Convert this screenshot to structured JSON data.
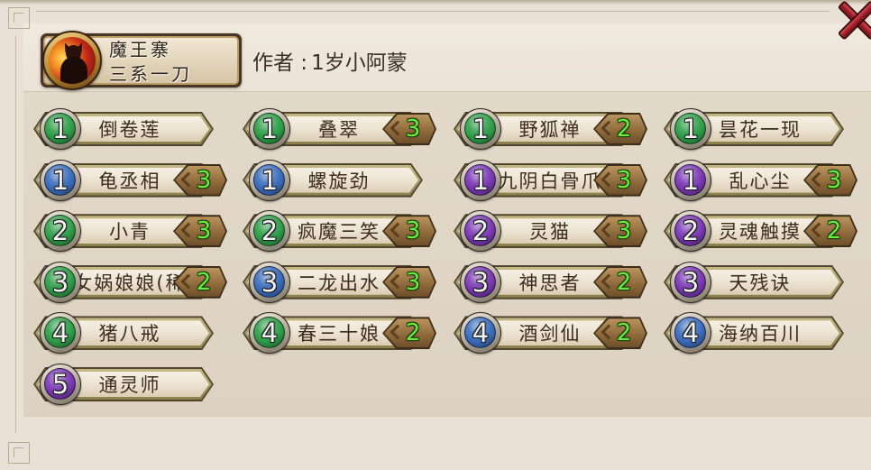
{
  "icons": {
    "close": "close-icon"
  },
  "deck": {
    "name": "魔王寨",
    "subtitle": "三系一刀",
    "author_label": "作者 :",
    "author_name": "1岁小阿蒙"
  },
  "colors": {
    "count_text": "#66ee3a",
    "name_text": "#3b2c1e",
    "close_red": "#b3262e"
  },
  "cards": [
    {
      "cost": 1,
      "name": "倒卷莲",
      "count": null,
      "gem_color": "#2e9e48"
    },
    {
      "cost": 1,
      "name": "叠翠",
      "count": 3,
      "gem_color": "#2e9e48"
    },
    {
      "cost": 1,
      "name": "野狐禅",
      "count": 2,
      "gem_color": "#2e9e48"
    },
    {
      "cost": 1,
      "name": "昙花一现",
      "count": null,
      "gem_color": "#2e9e48"
    },
    {
      "cost": 1,
      "name": "龟丞相",
      "count": 3,
      "gem_color": "#3a6cbc"
    },
    {
      "cost": 1,
      "name": "螺旋劲",
      "count": null,
      "gem_color": "#3a6cbc"
    },
    {
      "cost": 1,
      "name": "九阴白骨爪",
      "count": 3,
      "gem_color": "#7a38b4"
    },
    {
      "cost": 1,
      "name": "乱心尘",
      "count": 3,
      "gem_color": "#7a38b4"
    },
    {
      "cost": 2,
      "name": "小青",
      "count": 3,
      "gem_color": "#2e9e48"
    },
    {
      "cost": 2,
      "name": "疯魔三笑",
      "count": 3,
      "gem_color": "#2e9e48"
    },
    {
      "cost": 2,
      "name": "灵猫",
      "count": 3,
      "gem_color": "#7a38b4"
    },
    {
      "cost": 2,
      "name": "灵魂触摸",
      "count": 2,
      "gem_color": "#7a38b4"
    },
    {
      "cost": 3,
      "name": "女娲娘娘(稀",
      "count": 2,
      "gem_color": "#2e9e48"
    },
    {
      "cost": 3,
      "name": "二龙出水",
      "count": 3,
      "gem_color": "#3a6cbc"
    },
    {
      "cost": 3,
      "name": "神思者",
      "count": 2,
      "gem_color": "#7a38b4"
    },
    {
      "cost": 3,
      "name": "天残诀",
      "count": null,
      "gem_color": "#7a38b4"
    },
    {
      "cost": 4,
      "name": "猪八戒",
      "count": null,
      "gem_color": "#2e9e48"
    },
    {
      "cost": 4,
      "name": "春三十娘",
      "count": 2,
      "gem_color": "#2e9e48"
    },
    {
      "cost": 4,
      "name": "酒剑仙",
      "count": 2,
      "gem_color": "#3a6cbc"
    },
    {
      "cost": 4,
      "name": "海纳百川",
      "count": null,
      "gem_color": "#3a6cbc"
    },
    {
      "cost": 5,
      "name": "通灵师",
      "count": null,
      "gem_color": "#7a38b4"
    }
  ]
}
